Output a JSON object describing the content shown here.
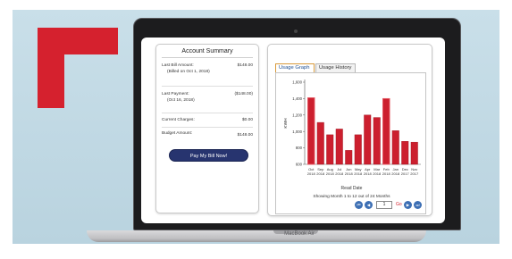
{
  "device": {
    "brand_label": "MacBook Air"
  },
  "account_summary": {
    "title": "Account Summary",
    "last_bill_label": "Last Bill Amount:",
    "last_bill_sub": "(Billed on Oct 1, 2018)",
    "last_bill_value": "$148.00",
    "last_payment_label": "Last Payment:",
    "last_payment_sub": "(Oct 16, 2018)",
    "last_payment_value": "($148.00)",
    "current_charges_label": "Current Charges:",
    "current_charges_value": "$0.00",
    "budget_amount_label": "Budget Amount:",
    "budget_amount_value": "$148.00",
    "pay_button_label": "Pay My Bill Now!"
  },
  "usage": {
    "tabs": [
      {
        "label": "Usage Graph",
        "active": true
      },
      {
        "label": "Usage History",
        "active": false
      }
    ],
    "xlabel": "Read Date",
    "showing_text": "Showing Month 1 to 12 out of 24 Months",
    "page_value": "1",
    "go_label": "Go",
    "pager_icons": [
      "first-page-icon",
      "previous-page-icon",
      "next-page-icon",
      "last-page-icon"
    ]
  },
  "colors": {
    "bar": "#cc1f2e",
    "bar_highlight": "#e65a64",
    "button": "#27346f",
    "pager": "#3d6fb4",
    "brand_red": "#d5212e"
  },
  "chart_data": {
    "type": "bar",
    "categories": [
      "Oct 2018",
      "Sep 2018",
      "Aug 2018",
      "Jul 2018",
      "Jun 2018",
      "May 2018",
      "Apr 2018",
      "Mar 2018",
      "Feb 2018",
      "Jan 2018",
      "Dec 2017",
      "Nov 2017"
    ],
    "category_months": [
      "Oct",
      "Sep",
      "Aug",
      "Jul",
      "Jun",
      "May",
      "Apr",
      "Mar",
      "Feb",
      "Jan",
      "Dec",
      "Nov"
    ],
    "category_years": [
      "2018",
      "2018",
      "2018",
      "2018",
      "2018",
      "2018",
      "2018",
      "2018",
      "2018",
      "2018",
      "2017",
      "2017"
    ],
    "values": [
      1410,
      1110,
      960,
      1030,
      770,
      960,
      1200,
      1170,
      1400,
      1010,
      880,
      870
    ],
    "xlabel": "Read Date",
    "ylabel": "KWH",
    "ylim": [
      600,
      1600
    ],
    "yticks": [
      600,
      800,
      1000,
      1200,
      1400,
      1600
    ],
    "ytick_labels": [
      "600",
      "800",
      "1,000",
      "1,200",
      "1,400",
      "1,600"
    ],
    "grid": false
  }
}
